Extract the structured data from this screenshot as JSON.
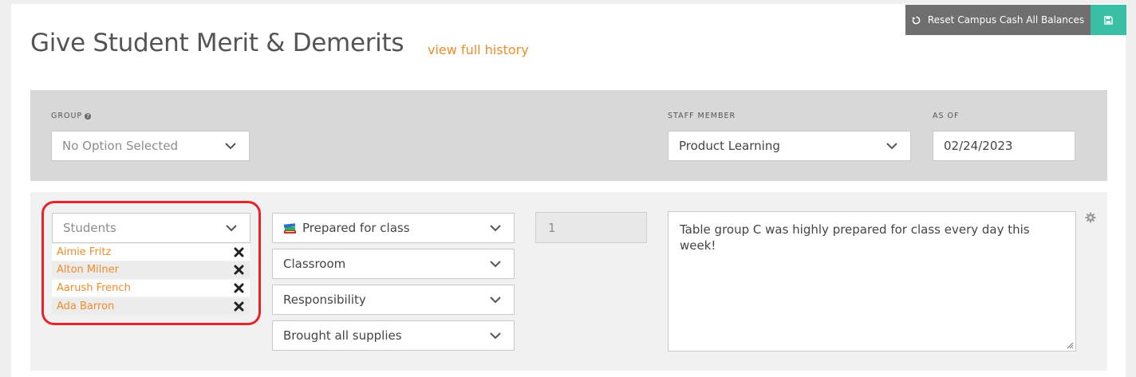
{
  "header": {
    "title": "Give Student Merit & Demerits",
    "history_link": "view full history",
    "reset_button_label": "Reset Campus Cash All Balances"
  },
  "filters": {
    "group_label": "GROUP",
    "group_value": "No Option Selected",
    "staff_label": "STAFF MEMBER",
    "staff_value": "Product Learning",
    "as_of_label": "AS OF",
    "as_of_value": "02/24/2023"
  },
  "entry": {
    "students_placeholder": "Students",
    "students": [
      "Aimie Fritz",
      "Alton Milner",
      "Aarush French",
      "Ada Barron"
    ],
    "behavior": "Prepared for class",
    "location": "Classroom",
    "category": "Responsibility",
    "detail": "Brought all supplies",
    "quantity": "1",
    "comment": "Table group C was highly prepared for class every day this week!"
  },
  "colors": {
    "accent_orange": "#f08c2a",
    "save_green": "#3bbfa4",
    "highlight_red": "#e8232b",
    "reset_gray": "#6f6f6f"
  }
}
